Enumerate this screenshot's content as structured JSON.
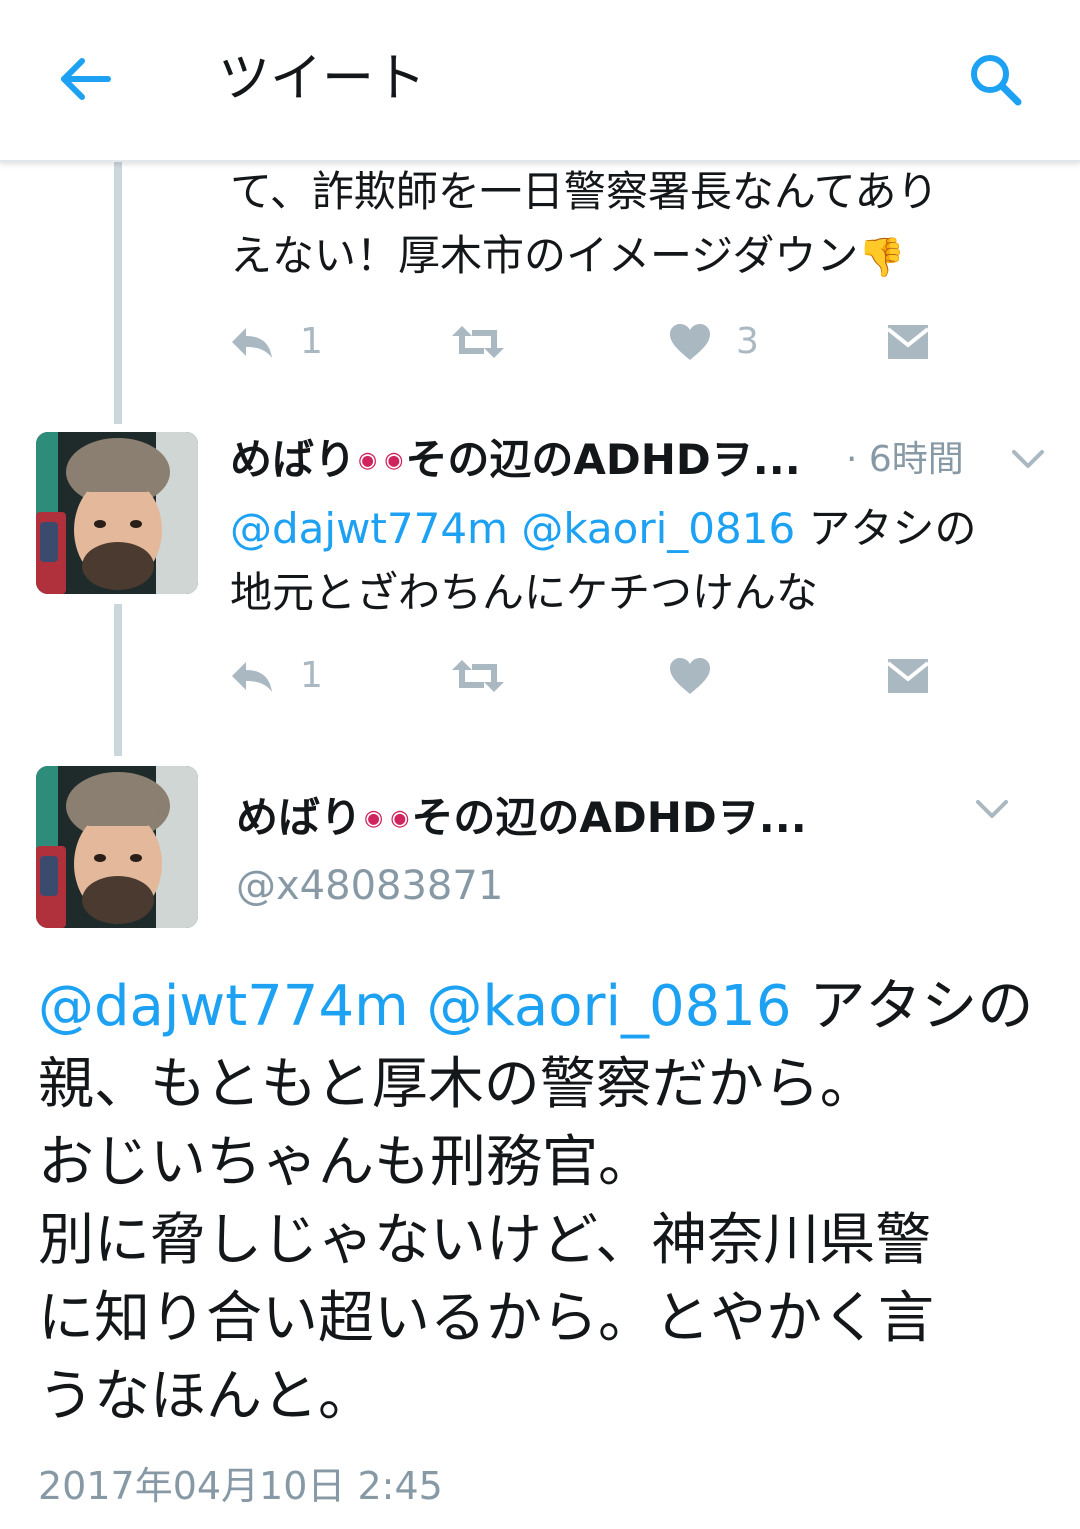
{
  "header": {
    "title": "ツイート",
    "back_icon": "arrow-left-icon",
    "search_icon": "search-icon",
    "accent": "#1da1f2"
  },
  "tweet1": {
    "text_line1": "て、詐欺師を一日警察署長なんてあり",
    "text_line2": "えない！厚木市のイメージダウン",
    "emoji": "👎",
    "reply_count": "1",
    "like_count": "3"
  },
  "tweet2": {
    "display_name_a": "めばり",
    "display_name_b": "その辺のADHDヲ...",
    "time": "· 6時間",
    "mention1": "@dajwt774m",
    "mention2": "@kaori_0816",
    "text_line1_rest": " アタシの",
    "text_line2": "地元とざわちんにケチつけんな",
    "reply_count": "1"
  },
  "main_tweet": {
    "display_name_a": "めばり",
    "display_name_b": "その辺のADHDヲ...",
    "handle": "@x48083871",
    "mention1": "@dajwt774m",
    "mention2": "@kaori_0816",
    "line1_rest": " アタシの",
    "line2": "親、もともと厚木の警察だから。",
    "line3": "おじいちゃんも刑務官。",
    "line4": "別に脅しじゃないけど、神奈川県警",
    "line5": "に知り合い超いるから。とやかく言",
    "line6": "うなほんと。",
    "timestamp": "2017年04月10日 2:45"
  },
  "colors": {
    "text": "#14171a",
    "muted": "#8899a6",
    "icon_gray": "#aab8c2",
    "link": "#1da1f2",
    "thread_line": "#ccd6dd",
    "emoji_pink": "#e0245e"
  }
}
